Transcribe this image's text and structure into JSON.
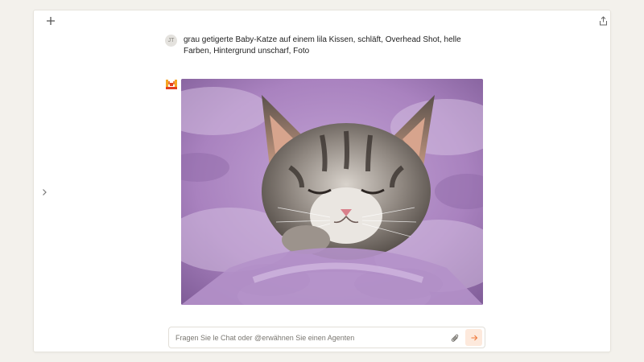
{
  "toolbar": {
    "new_chat_icon": "plus-icon",
    "share_icon": "share-icon",
    "sidebar_toggle_icon": "chevron-right-icon"
  },
  "conversation": {
    "user": {
      "initials": "JT",
      "message": "grau getigerte Baby-Katze auf einem lila Kissen, schläft, Overhead Shot, helle Farben, Hintergrund unscharf, Foto"
    },
    "assistant": {
      "icon": "agent-logo-icon",
      "image_subject": "sleeping tabby kitten on lilac blanket"
    }
  },
  "composer": {
    "placeholder": "Fragen Sie le Chat oder @erwähnen Sie einen Agenten",
    "value": "",
    "attach_icon": "paperclip-icon",
    "send_icon": "arrow-right-icon"
  },
  "colors": {
    "background": "#f3f1ec",
    "accent": "#f07a3c",
    "send_bg": "#fde9dc",
    "blanket": "#b89ac8"
  }
}
